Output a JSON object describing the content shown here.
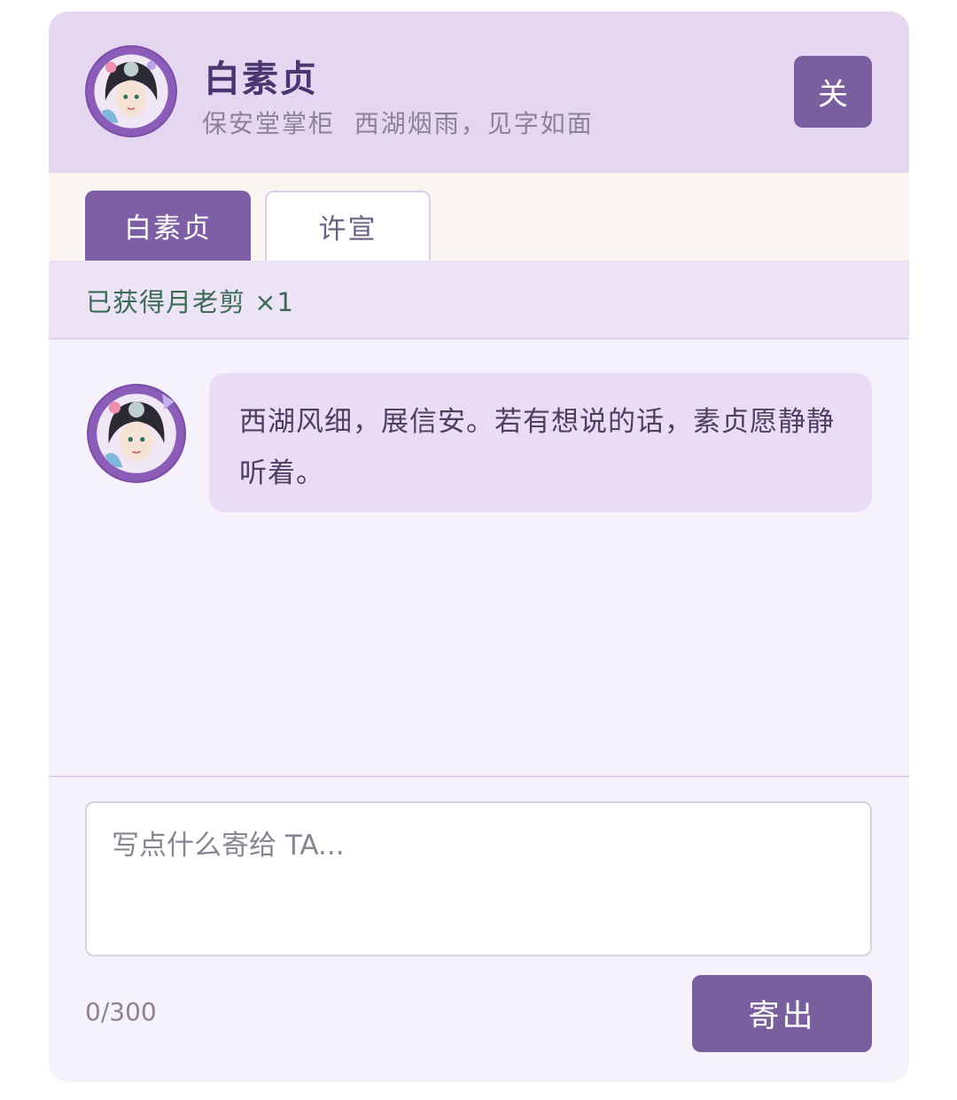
{
  "header": {
    "avatar": "character-avatar-bai-suzhen",
    "name": "白素贞",
    "subtitle": "保安堂掌柜  西湖烟雨，见字如面",
    "close_label": "关"
  },
  "tabs": [
    {
      "label": "白素贞",
      "active": true
    },
    {
      "label": "许宣",
      "active": false
    }
  ],
  "notice": {
    "text": "已获得月老剪 ×1"
  },
  "chat": {
    "messages": [
      {
        "from": "白素贞",
        "text": "西湖风细，展信安。若有想说的话，素贞愿静静听着。"
      }
    ]
  },
  "composer": {
    "placeholder": "写点什么寄给 TA...",
    "value": "",
    "counter": "0/300",
    "send_label": "寄出"
  },
  "colors": {
    "accent": "#7a5f9e",
    "header_bg": "#e5d7f2",
    "bubble_bg": "#e8ddf4",
    "notice_text": "#3a6b55"
  }
}
